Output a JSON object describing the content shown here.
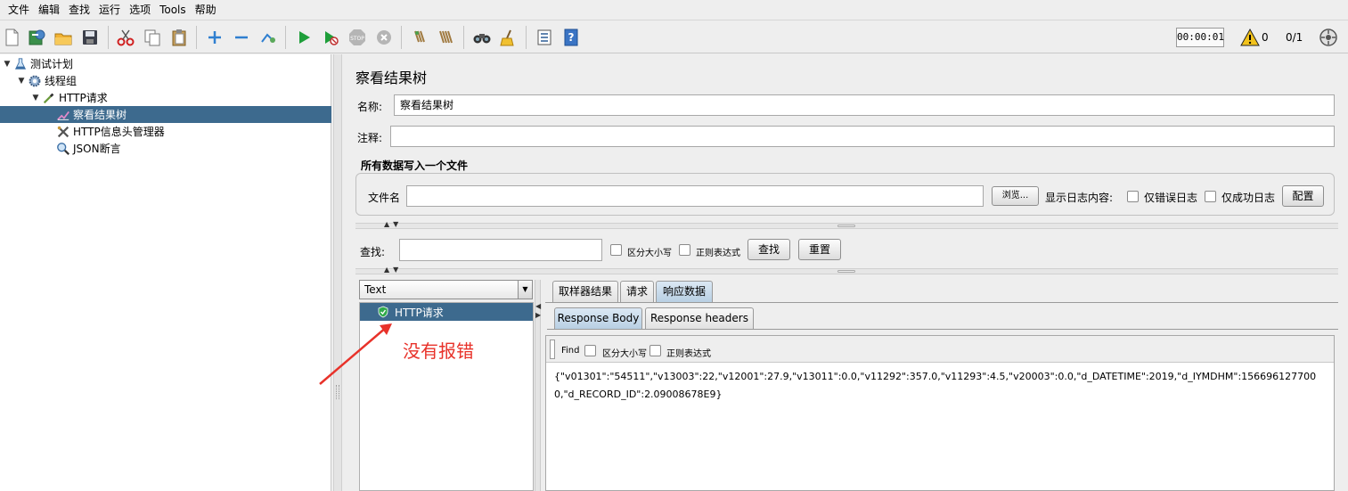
{
  "menu": [
    "文件",
    "编辑",
    "查找",
    "运行",
    "选项",
    "Tools",
    "帮助"
  ],
  "toolbar": {
    "timer": "00:00:01",
    "warning_count": "0",
    "thread_count": "0/1",
    "icons": [
      "new-icon",
      "templates-icon",
      "open-icon",
      "save-icon",
      "cut-icon",
      "copy-icon",
      "paste-icon",
      "expand-icon",
      "collapse-icon",
      "toggle-icon",
      "start-icon",
      "start-no-pause-icon",
      "stop-icon",
      "shutdown-icon",
      "clear-icon",
      "clear-all-icon",
      "search-icon",
      "reset-search-icon",
      "function-helper-icon",
      "help-icon",
      "remote-icon"
    ]
  },
  "tree": {
    "items": [
      {
        "label": "测试计划",
        "icon": "flask-icon"
      },
      {
        "label": "线程组",
        "icon": "gear-icon"
      },
      {
        "label": "HTTP请求",
        "icon": "pipette-icon"
      },
      {
        "label": "察看结果树",
        "icon": "chart-icon"
      },
      {
        "label": "HTTP信息头管理器",
        "icon": "tools-icon"
      },
      {
        "label": "JSON断言",
        "icon": "magnifier-icon"
      }
    ]
  },
  "panel": {
    "title": "察看结果树",
    "name_label": "名称:",
    "name_value": "察看结果树",
    "comment_label": "注释:",
    "comment_value": "",
    "file_group_title": "所有数据写入一个文件",
    "filename_label": "文件名",
    "filename_value": "",
    "browse_label": "浏览...",
    "log_content_label": "显示日志内容:",
    "errors_only_label": "仅错误日志",
    "success_only_label": "仅成功日志",
    "config_label": "配置"
  },
  "search": {
    "label": "查找:",
    "value": "",
    "case_label": "区分大小写",
    "regex_label": "正则表达式",
    "find_label": "查找",
    "reset_label": "重置"
  },
  "results": {
    "renderer": "Text",
    "items": [
      {
        "label": "HTTP请求",
        "status": "success"
      }
    ],
    "annotation": "没有报错"
  },
  "tabs": {
    "main": [
      "取样器结果",
      "请求",
      "响应数据"
    ],
    "active_main": 2,
    "sub": [
      "Response Body",
      "Response headers"
    ],
    "active_sub": 0
  },
  "response": {
    "find_label": "Find",
    "case_label": "区分大小写",
    "regex_label": "正则表达式",
    "body": "{\"v01301\":\"54511\",\"v13003\":22,\"v12001\":27.9,\"v13011\":0.0,\"v11292\":357.0,\"v11293\":4.5,\"v20003\":0.0,\"d_DATETIME\":2019,\"d_IYMDHM\":1566961277000,\"d_RECORD_ID\":2.09008678E9}"
  },
  "colors": {
    "selection": "#3d6a8e",
    "annotation": "#e8322a",
    "start_green": "#1e9e3a"
  }
}
